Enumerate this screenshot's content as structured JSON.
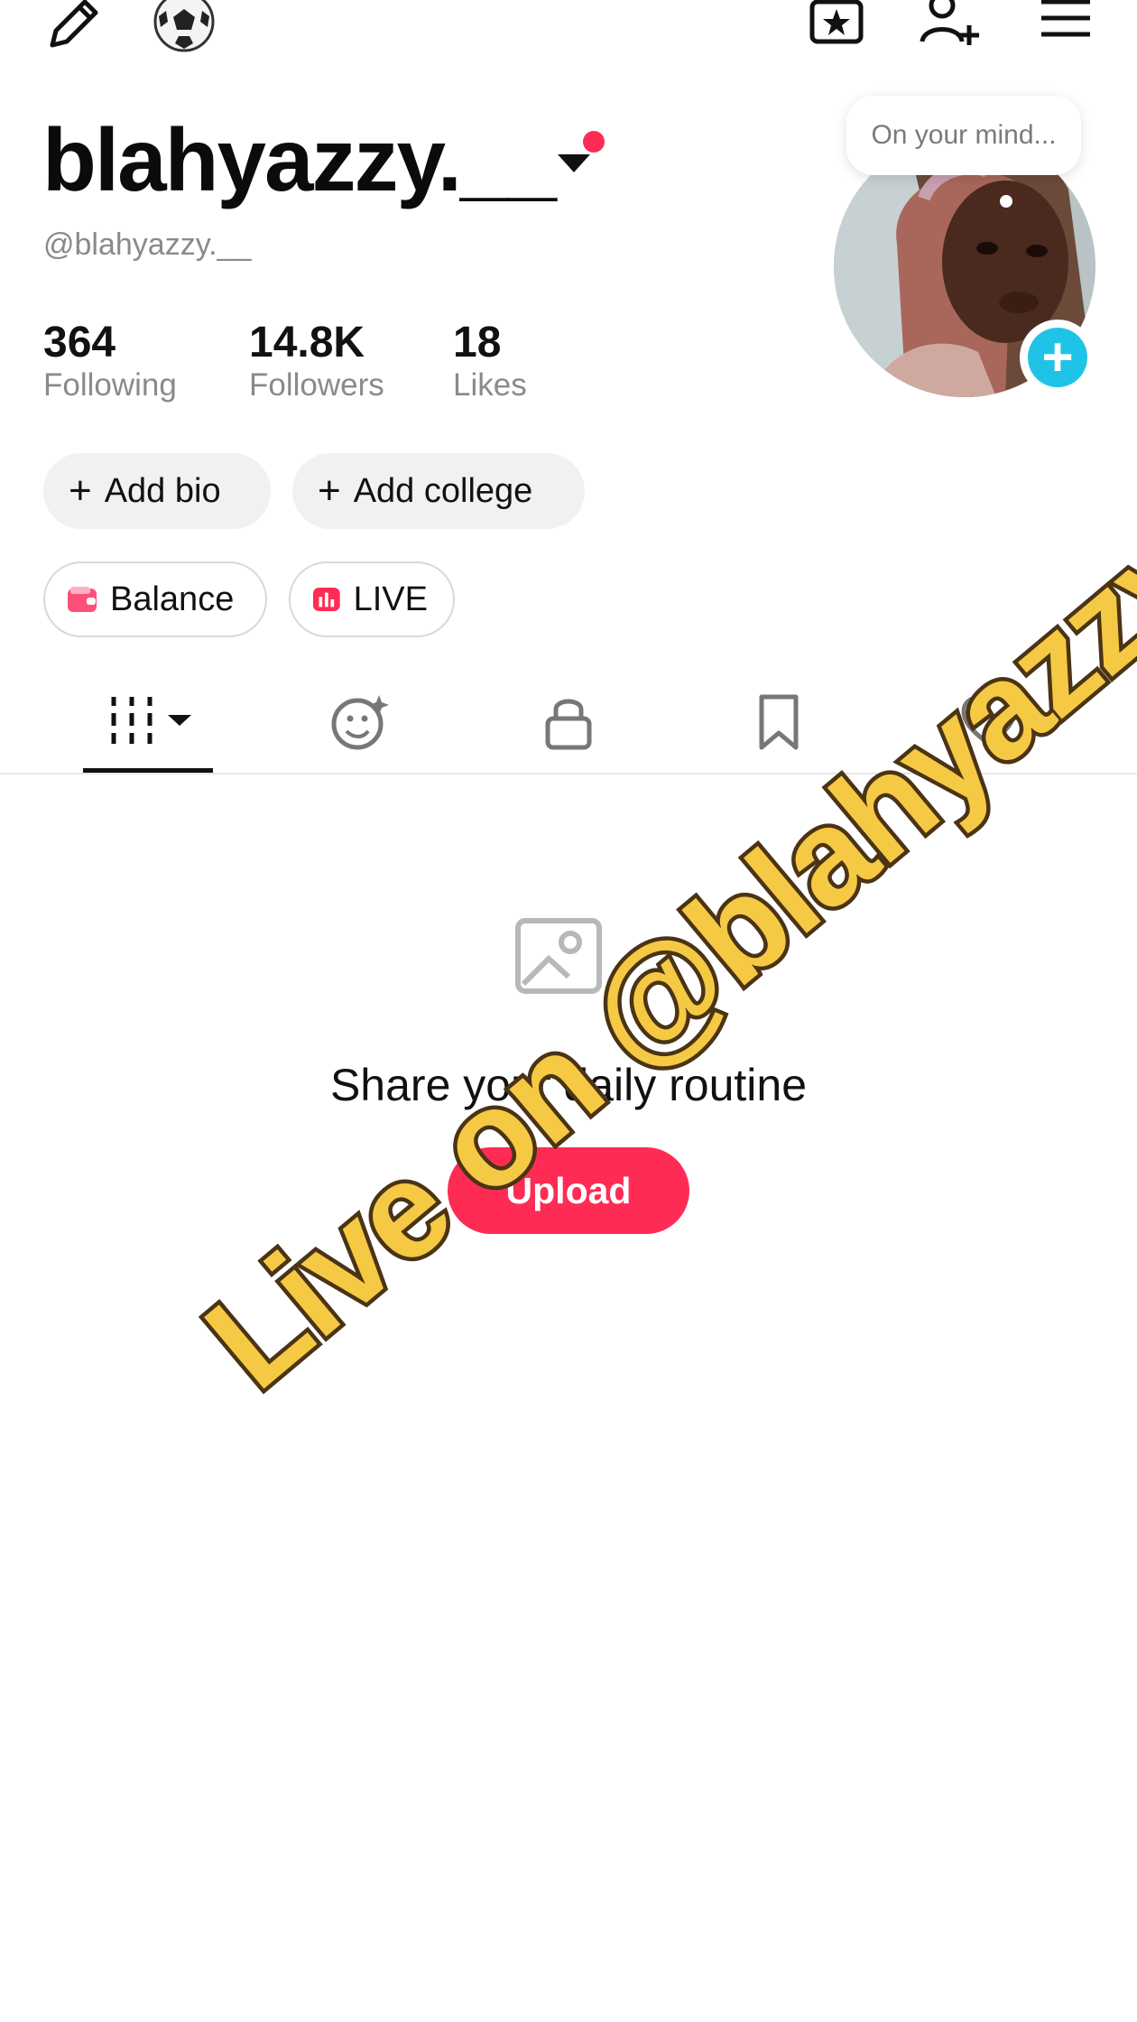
{
  "profile": {
    "username": "blahyazzy.__",
    "handle": "@blahyazzy.__",
    "note_placeholder": "On your mind..."
  },
  "stats": [
    {
      "value": "364",
      "label": "Following"
    },
    {
      "value": "14.8K",
      "label": "Followers"
    },
    {
      "value": "18",
      "label": "Likes"
    }
  ],
  "actions": {
    "add_bio": "Add bio",
    "add_college": "Add college",
    "balance": "Balance",
    "live": "LIVE"
  },
  "tabs": [
    "videos-grid-icon",
    "reposts-icon",
    "private-lock-icon",
    "favorites-bookmark-icon",
    "liked-heart-icon"
  ],
  "empty_state": {
    "title": "Share your daily routine",
    "button": "Upload"
  },
  "overlay": {
    "watermark": "Live on @blahyazzy.__"
  },
  "colors": {
    "accent": "#fe2c55",
    "add_button": "#20c3e8",
    "watermark_fill": "#f6c945"
  }
}
